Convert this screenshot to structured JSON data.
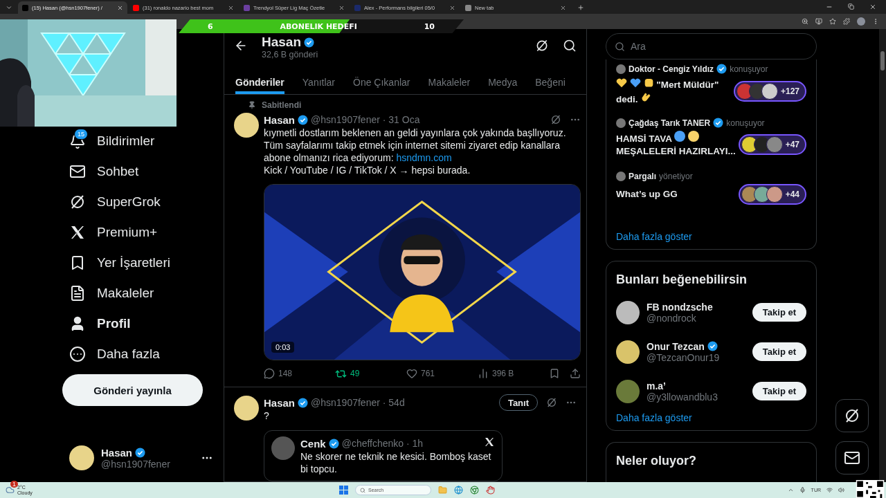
{
  "browser": {
    "tabs": [
      {
        "title": "(15) Hasan (@hsn1907fener) /",
        "selected": true
      },
      {
        "title": "(31) ronaldo nazario best mom",
        "selected": false
      },
      {
        "title": "Trendyol Süper Lig Maç Özetle",
        "selected": false
      },
      {
        "title": "Alex - Performans bilgileri 05/0",
        "selected": false
      },
      {
        "title": "New tab",
        "selected": false
      }
    ]
  },
  "stream_overlay": {
    "goal": {
      "start": "6",
      "title": "ABONELIK HEDEFI",
      "end": "10",
      "level": 0.6
    }
  },
  "sidebar": {
    "items": [
      {
        "label": "Bildirimler",
        "badge": "15",
        "selected": false
      },
      {
        "label": "Sohbet",
        "selected": false
      },
      {
        "label": "SuperGrok",
        "selected": false
      },
      {
        "label": "Premium+",
        "selected": false
      },
      {
        "label": "Yer İşaretleri",
        "selected": false
      },
      {
        "label": "Makaleler",
        "selected": false
      },
      {
        "label": "Profil",
        "selected": true
      },
      {
        "label": "Daha fazla",
        "selected": false
      }
    ],
    "post_button": "Gönderi yayınla",
    "account": {
      "name": "Hasan",
      "verified": true,
      "handle": "@hsn1907fener"
    }
  },
  "profile_header": {
    "name": "Hasan",
    "verified": true,
    "post_count": "32,6 B gönderi"
  },
  "profile_tabs": [
    {
      "label": "Gönderiler",
      "selected": true
    },
    {
      "label": "Yanıtlar",
      "selected": false
    },
    {
      "label": "Öne Çıkanlar",
      "selected": false
    },
    {
      "label": "Makaleler",
      "selected": false
    },
    {
      "label": "Medya",
      "selected": false
    },
    {
      "label": "Beğeni",
      "selected": false
    }
  ],
  "posts": [
    {
      "pinned_label": "Sabitlendi",
      "author": "Hasan",
      "verified": true,
      "meta": "@hsn1907fener · 31 Oca",
      "paragraphs": [
        {
          "text": "kıymetli dostlarım beklenen an geldi yayınlara çok yakında başllıyoruz. Tüm sayfalarımı takip etmek için internet sitemi ziyaret edip kanallara abone olmanızı rica ediyorum: ",
          "link": "hsndmn.com"
        },
        {
          "text": "Kick / YouTube / IG / TikTok / X → hepsi burada."
        }
      ],
      "media": {
        "kind": "picture",
        "duration": "0:03"
      },
      "actions": {
        "replies": "148",
        "reposts": "49",
        "reposted": true,
        "likes": "761",
        "liked": false,
        "views": "396 B"
      }
    },
    {
      "author": "Hasan",
      "verified": true,
      "meta": "@hsn1907fener · 54d",
      "promote_button": "Tanıt",
      "paragraphs": [
        {
          "text": "?"
        }
      ],
      "quote": {
        "author": "Cenk",
        "verified": true,
        "meta": "@cheffchenko · 1h",
        "text": "Ne skorer ne teknik ne kesici. Bomboş kaset bi topcu."
      }
    }
  ],
  "search": {
    "placeholder": "Ara"
  },
  "spaces": {
    "items": [
      {
        "host": "Doktor - Cengiz Yıldız",
        "verified": true,
        "role": "konuşuyor",
        "title": [
          {
            "kind": "heart",
            "color": "#f7c948"
          },
          {
            "kind": "heart",
            "color": "#4a9ff5"
          },
          {
            "kind": "fist",
            "color": "#f7c948"
          },
          {
            "kind": "text",
            "text": "\"Mert Müldür\" dedi."
          },
          {
            "kind": "clap",
            "color": "#f7c948"
          }
        ],
        "count": "+127"
      },
      {
        "host": "Çağdaş Tarık TANER",
        "verified": true,
        "role": "konuşuyor",
        "title": [
          {
            "kind": "text",
            "text": "HAMSİ TAVA"
          },
          {
            "kind": "dot",
            "color": "#4a9ff5"
          },
          {
            "kind": "dot",
            "color": "#f7d26a"
          },
          {
            "kind": "text",
            "text": "MEŞALELERİ HAZIRLAYI..."
          }
        ],
        "count": "+47"
      },
      {
        "host": "Pargalı",
        "verified": false,
        "role": "yönetiyor",
        "title": [
          {
            "kind": "text",
            "text": "What’s up GG"
          }
        ],
        "count": "+44"
      }
    ],
    "more": "Daha fazla göster"
  },
  "who_to_follow": {
    "title": "Bunları beğenebilirsin",
    "users": [
      {
        "name": "FB nondzsche",
        "verified": false,
        "handle": "@nondrock",
        "button": "Takip et"
      },
      {
        "name": "Onur Tezcan",
        "verified": true,
        "handle": "@TezcanOnur19",
        "button": "Takip et"
      },
      {
        "name": "m.a’",
        "verified": false,
        "handle": "@y3llowandblu3",
        "button": "Takip et"
      }
    ],
    "more": "Daha fazla göster"
  },
  "trends": {
    "title": "Neler oluyor?"
  },
  "taskbar": {
    "weather": {
      "temp": "2°C",
      "desc": "Cloudy",
      "badge": "1"
    },
    "search": {
      "placeholder": "Search"
    },
    "language": "TUR"
  }
}
